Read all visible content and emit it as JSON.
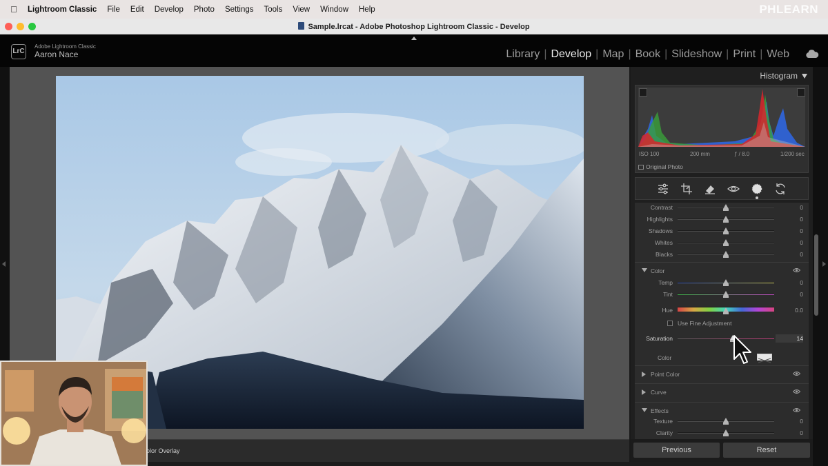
{
  "menubar": {
    "app": "Lightroom Classic",
    "items": [
      "File",
      "Edit",
      "Develop",
      "Photo",
      "Settings",
      "Tools",
      "View",
      "Window",
      "Help"
    ],
    "watermark": "PHLEARN"
  },
  "window": {
    "title": "Sample.lrcat - Adobe Photoshop Lightroom Classic - Develop"
  },
  "identity": {
    "small_text": "Adobe Lightroom Classic",
    "user_name": "Aaron Nace",
    "logo_text": "LrC"
  },
  "modules": [
    {
      "label": "Library",
      "active": false
    },
    {
      "label": "Develop",
      "active": true
    },
    {
      "label": "Map",
      "active": false
    },
    {
      "label": "Book",
      "active": false
    },
    {
      "label": "Slideshow",
      "active": false
    },
    {
      "label": "Print",
      "active": false
    },
    {
      "label": "Web",
      "active": false
    }
  ],
  "toolbar": {
    "overlay_label": "olor Overlay"
  },
  "histogram": {
    "title": "Histogram",
    "meta": {
      "iso": "ISO 100",
      "focal": "200 mm",
      "aperture": "ƒ / 8.0",
      "shutter": "1/200 sec"
    },
    "original_photo": "Original Photo"
  },
  "tools": [
    "sliders-icon",
    "crop-icon",
    "healing-icon",
    "redeye-icon",
    "masking-icon",
    "reset-tool-icon"
  ],
  "basic_rows": [
    {
      "label": "Contrast",
      "value": "0",
      "pos": 0.5
    },
    {
      "label": "Highlights",
      "value": "0",
      "pos": 0.5
    },
    {
      "label": "Shadows",
      "value": "0",
      "pos": 0.5
    },
    {
      "label": "Whites",
      "value": "0",
      "pos": 0.5
    },
    {
      "label": "Blacks",
      "value": "0",
      "pos": 0.5
    }
  ],
  "color_section": {
    "title": "Color",
    "rows": [
      {
        "label": "Temp",
        "value": "0",
        "pos": 0.5
      },
      {
        "label": "Tint",
        "value": "0",
        "pos": 0.5
      },
      {
        "label": "Hue",
        "value": "0.0",
        "pos": 0.5
      }
    ],
    "fine_adjust": "Use Fine Adjustment",
    "saturation": {
      "label": "Saturation",
      "value": "14",
      "pos": 0.57
    },
    "color_label": "Color"
  },
  "collapsed_sections": [
    "Point Color",
    "Curve"
  ],
  "effects_section": {
    "title": "Effects",
    "rows": [
      {
        "label": "Texture",
        "value": "0",
        "pos": 0.5
      },
      {
        "label": "Clarity",
        "value": "0",
        "pos": 0.5
      }
    ]
  },
  "buttons": {
    "previous": "Previous",
    "reset": "Reset"
  },
  "colors": {
    "accent_active": "#f0f0f0",
    "panel_bg": "#2c2c2c",
    "hist_red": "#d8262c",
    "hist_green": "#3aa03a",
    "hist_blue": "#2f63d6"
  }
}
